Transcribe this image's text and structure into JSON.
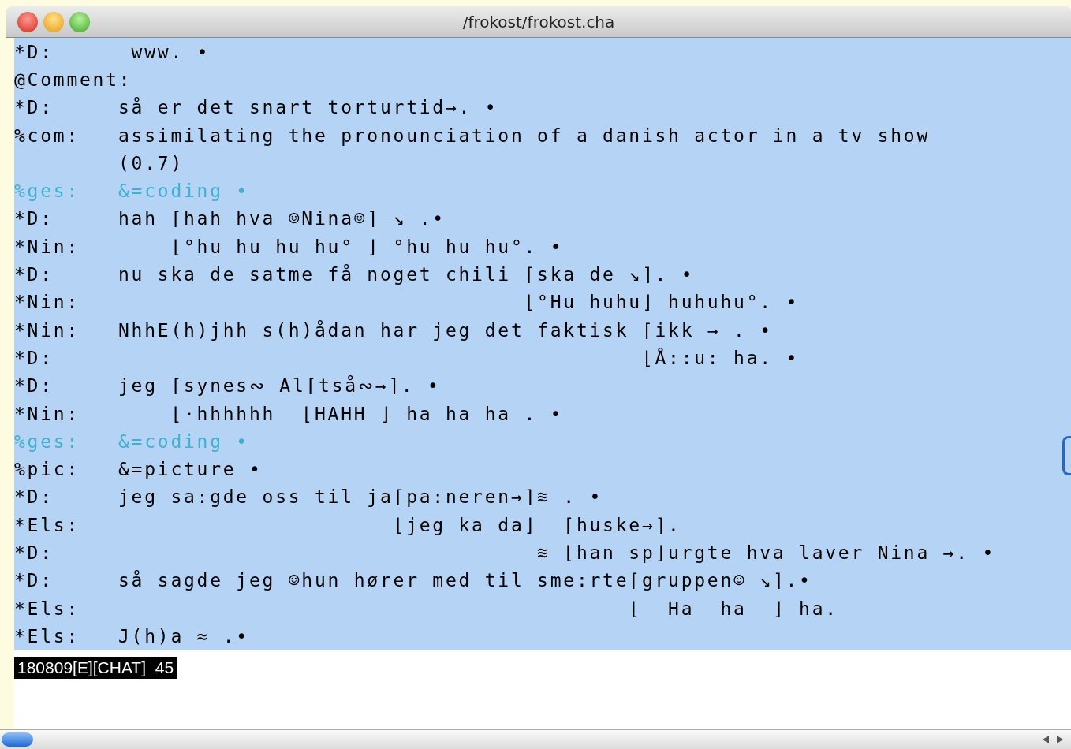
{
  "window": {
    "title": "/frokost/frokost.cha"
  },
  "lines": [
    {
      "speaker": "*D:",
      "text": " www. •",
      "color": "#000000"
    },
    {
      "speaker": "@Comment:",
      "color": "#000000"
    },
    {
      "speaker": "*D:",
      "text": "så er det snart torturtid→. •",
      "color": "#000000"
    },
    {
      "speaker": "%com:",
      "text": "assimilating the pronounciation of a danish actor in a tv show",
      "color": "#000000"
    },
    {
      "text": "(0.7)",
      "color": "#000000"
    },
    {
      "speaker": "%ges:",
      "text": "&=coding •",
      "color": "#3fb0cf"
    },
    {
      "speaker": "*D:",
      "text": "hah ⌈hah hva ☺Nina☺⌉ ↘ .•",
      "color": "#000000"
    },
    {
      "speaker": "*Nin:",
      "text": "    ⌊°hu hu hu hu° ⌋ °hu hu hu°. •",
      "color": "#000000"
    },
    {
      "speaker": "*D:",
      "text": "nu ska de satme få noget chili ⌈ska de ↘⌉. •",
      "color": "#000000"
    },
    {
      "speaker": "*Nin:",
      "text": "                               ⌊°Hu huhu⌋ huhuhu°. •",
      "color": "#000000"
    },
    {
      "speaker": "*Nin:",
      "text": "NhhE(h)jhh s(h)ådan har jeg det faktisk ⌈ikk → . •",
      "color": "#000000"
    },
    {
      "speaker": "*D:",
      "text": "                                        ⌊Å::u: ha. •",
      "color": "#000000"
    },
    {
      "speaker": "*D:",
      "text": "jeg ⌈synes∾ Al⌈tså∾→⌉. •",
      "color": "#000000"
    },
    {
      "speaker": "*Nin:",
      "text": "    ⌊·hhhhhh  ⌊HAHH ⌋ ha ha ha . •",
      "color": "#000000"
    },
    {
      "speaker": "%ges:",
      "text": "&=coding •",
      "color": "#3fb0cf"
    },
    {
      "speaker": "%pic:",
      "text": "&=picture •",
      "color": "#000000"
    },
    {
      "speaker": "*D:",
      "text": "jeg sa:gde oss til ja⌈pa:neren→⌉≋ . •",
      "color": "#000000"
    },
    {
      "speaker": "*Els:",
      "text": "                     ⌊jeg ka da⌋  ⌈huske→⌉.",
      "color": "#000000"
    },
    {
      "speaker": "*D:",
      "text": "                                ≋ ⌊han sp⌋urgte hva laver Nina →. •",
      "color": "#000000"
    },
    {
      "speaker": "*D:",
      "text": "så sagde jeg ☺hun hører med til sme:rte⌈gruppen☺ ↘⌉.•",
      "color": "#000000"
    },
    {
      "speaker": "*Els:",
      "text": "                                       ⌊  Ha  ha  ⌋ ha.",
      "color": "#000000"
    },
    {
      "speaker": "*Els:",
      "text": "J(h)a ≈ .•",
      "color": "#000000"
    }
  ],
  "status": "180809[E][CHAT]  45"
}
